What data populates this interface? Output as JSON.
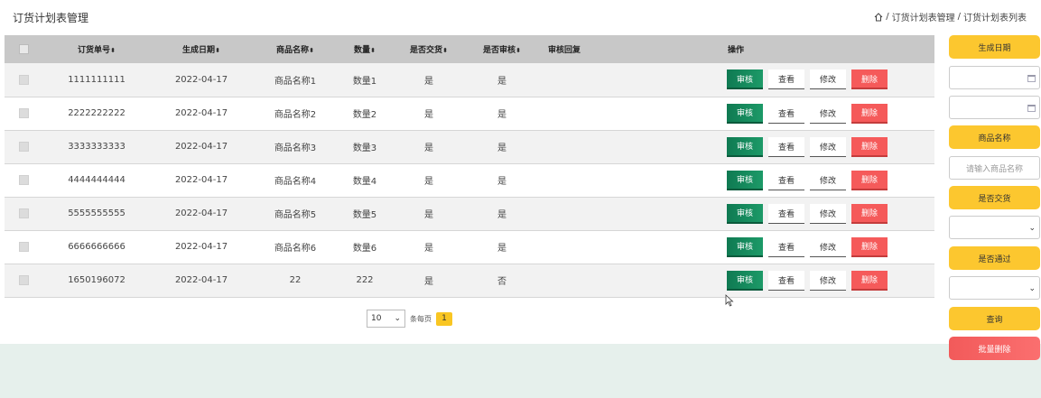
{
  "page": {
    "title": "订货计划表管理"
  },
  "breadcrumb": {
    "sep1": "/",
    "item1": "订货计划表管理",
    "sep2": "/",
    "item2": "订货计划表列表"
  },
  "table": {
    "headers": {
      "order_no": "订货单号",
      "date": "生成日期",
      "product": "商品名称",
      "qty": "数量",
      "delivered": "是否交货",
      "reviewed": "是否审核",
      "reply": "审核回复",
      "ops": "操作"
    },
    "sort_icon": "⬍",
    "op_labels": {
      "review": "审核",
      "view": "查看",
      "edit": "修改",
      "delete": "删除"
    },
    "rows": [
      {
        "order_no": "1111111111",
        "date": "2022-04-17",
        "product": "商品名称1",
        "qty": "数量1",
        "delivered": "是",
        "reviewed": "是",
        "reply": ""
      },
      {
        "order_no": "2222222222",
        "date": "2022-04-17",
        "product": "商品名称2",
        "qty": "数量2",
        "delivered": "是",
        "reviewed": "是",
        "reply": ""
      },
      {
        "order_no": "3333333333",
        "date": "2022-04-17",
        "product": "商品名称3",
        "qty": "数量3",
        "delivered": "是",
        "reviewed": "是",
        "reply": ""
      },
      {
        "order_no": "4444444444",
        "date": "2022-04-17",
        "product": "商品名称4",
        "qty": "数量4",
        "delivered": "是",
        "reviewed": "是",
        "reply": ""
      },
      {
        "order_no": "5555555555",
        "date": "2022-04-17",
        "product": "商品名称5",
        "qty": "数量5",
        "delivered": "是",
        "reviewed": "是",
        "reply": ""
      },
      {
        "order_no": "6666666666",
        "date": "2022-04-17",
        "product": "商品名称6",
        "qty": "数量6",
        "delivered": "是",
        "reviewed": "是",
        "reply": ""
      },
      {
        "order_no": "1650196072",
        "date": "2022-04-17",
        "product": "22",
        "qty": "222",
        "delivered": "是",
        "reviewed": "否",
        "reply": ""
      }
    ]
  },
  "pager": {
    "page_size": "10",
    "per_page_label": "条每页",
    "current_page": "1"
  },
  "sidebar": {
    "date_label": "生成日期",
    "date_start": "",
    "date_end": "",
    "product_label": "商品名称",
    "product_placeholder": "请输入商品名称",
    "delivered_label": "是否交货",
    "delivered_value": "",
    "passed_label": "是否通过",
    "passed_value": "",
    "query_button": "查询",
    "batch_delete_button": "批量删除"
  },
  "colors": {
    "accent_yellow": "#fcc72f",
    "review_green": "#0f7a52",
    "delete_red": "#f55a5a",
    "header_gray": "#c8c8c8"
  },
  "icons": {
    "home": "home-icon",
    "calendar": "calendar-icon",
    "chevron": "chevron-down-icon",
    "cursor": "mouse-cursor-icon"
  }
}
